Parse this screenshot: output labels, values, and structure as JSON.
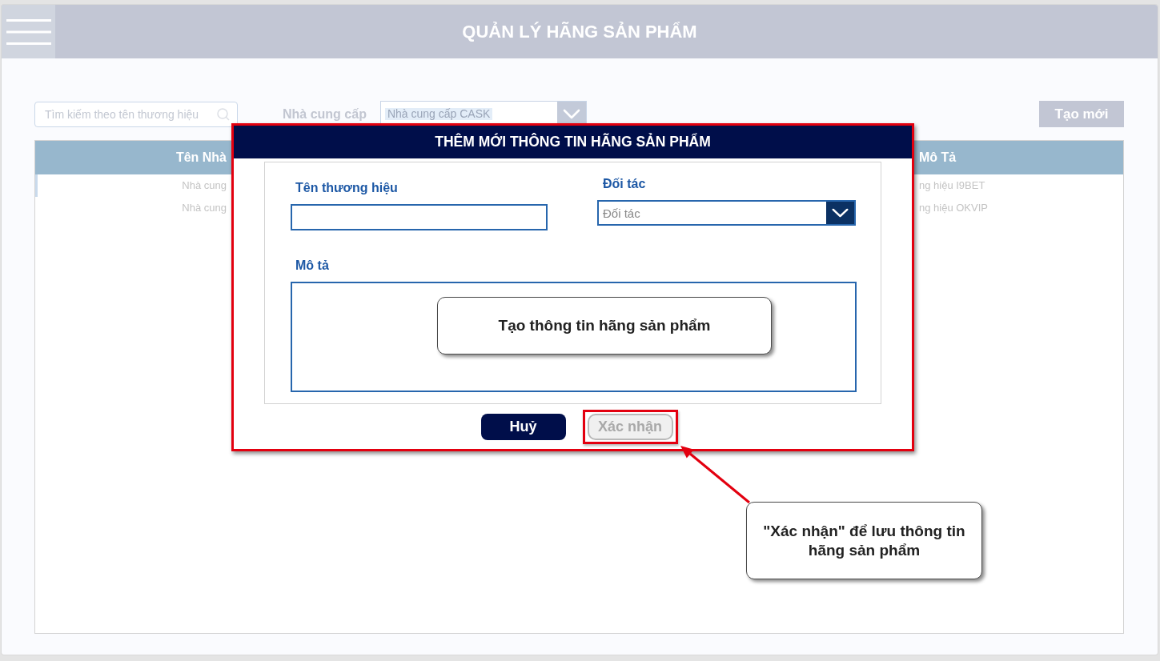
{
  "header": {
    "title": "QUẢN LÝ HÃNG SẢN PHẨM"
  },
  "toolbar": {
    "search": {
      "placeholder": "Tìm kiếm theo tên thương hiệu"
    },
    "supplier_filter": {
      "label": "Nhà cung cấp",
      "value": "Nhà cung cấp CASK"
    },
    "create_button": {
      "label": "Tạo mới"
    }
  },
  "table": {
    "columns": [
      "Tên Nhà",
      "Mô Tả"
    ],
    "rows": [
      {
        "selected": true,
        "cells": [
          "Nhà cung",
          "ng hiệu I9BET"
        ]
      },
      {
        "selected": false,
        "cells": [
          "Nhà cung",
          "ng hiệu OKVIP"
        ]
      }
    ]
  },
  "dialog": {
    "title": "THÊM MỚI THÔNG TIN HÃNG SẢN PHẨM",
    "highlighted": true,
    "fields": [
      {
        "kind": "text",
        "label": "Tên thương hiệu"
      },
      {
        "kind": "select",
        "label": "Đối tác",
        "placeholder": "Đối tác"
      },
      {
        "kind": "textarea",
        "label": "Mô tả"
      }
    ],
    "buttons": [
      {
        "label": "Huỷ",
        "disabled": false,
        "highlighted": false
      },
      {
        "label": "Xác nhận",
        "disabled": true,
        "highlighted": true
      }
    ]
  },
  "annotations": [
    {
      "kind": "note",
      "text": "Tạo thông tin hãng sản phẩm"
    },
    {
      "kind": "pointer",
      "text": "\"Xác nhận\" để lưu thông tin hãng sản phẩm"
    }
  ]
}
